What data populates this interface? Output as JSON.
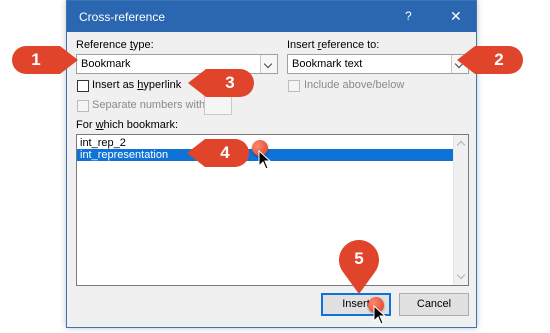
{
  "dialog": {
    "title": "Cross-reference",
    "help": "?",
    "close": "✕",
    "reference_type": {
      "label_pre": "Reference ",
      "label_u": "t",
      "label_post": "ype:",
      "value": "Bookmark"
    },
    "insert_reference_to": {
      "label_pre": "Insert ",
      "label_u": "r",
      "label_post": "eference to:",
      "value": "Bookmark text"
    },
    "insert_as_hyperlink": {
      "label_pre": "Insert as ",
      "label_u": "h",
      "label_post": "yperlink",
      "checked": false
    },
    "include_above_below": {
      "label": "Include above/below",
      "enabled": false
    },
    "separate_numbers": {
      "label": "Separate numbers with",
      "enabled": false
    },
    "for_which": {
      "label_pre": "For ",
      "label_u": "w",
      "label_post": "hich bookmark:",
      "items": [
        "int_rep_2",
        "int_representation"
      ],
      "selected_index": 1
    },
    "insert_button": "Insert",
    "cancel_button": "Cancel"
  },
  "callouts": [
    "1",
    "2",
    "3",
    "4",
    "5"
  ],
  "colors": {
    "titlebar": "#2b66b0",
    "selection": "#0f72d6",
    "callout": "#e0452b"
  }
}
